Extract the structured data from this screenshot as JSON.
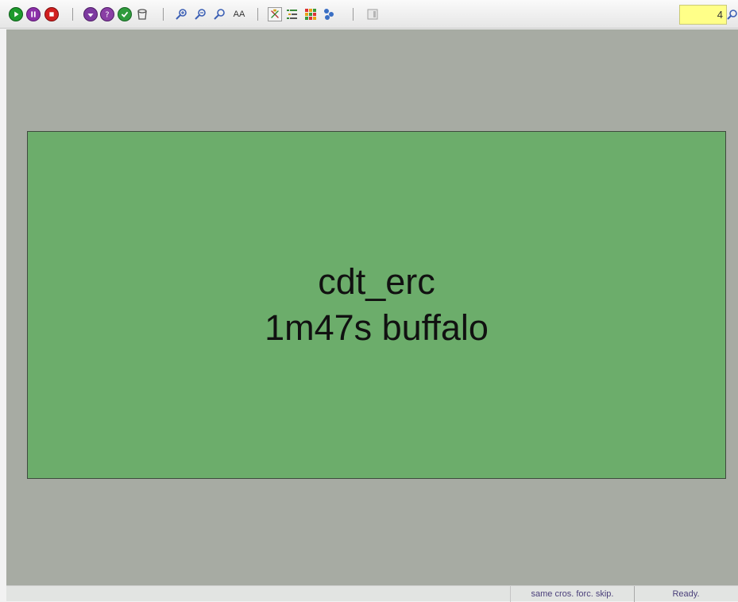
{
  "toolbar": {
    "run_icons": [
      "play-icon",
      "pause-icon",
      "stop-icon"
    ],
    "status_icons": [
      "down-arrow-icon",
      "question-icon",
      "check-icon",
      "bucket-icon"
    ],
    "zoom_icons": [
      "zoom-in-icon",
      "zoom-out-icon",
      "zoom-fit-icon",
      "font-size-icon"
    ],
    "font_size_label": "AA",
    "view_icons": [
      "tree-view-icon",
      "list-view-icon",
      "grid-view-icon",
      "tool-icon"
    ],
    "extra_icons": [
      "panel-icon"
    ],
    "zoom_value": "4"
  },
  "canvas": {
    "task": {
      "name": "cdt_erc",
      "detail": "1m47s buffalo"
    }
  },
  "status": {
    "flags": "same cros. forc. skip.",
    "state": "Ready."
  },
  "colors": {
    "canvas_bg": "#a7aba3",
    "task_fill": "#6cad6b",
    "zoom_field": "#ffff88",
    "play": "#1c9a2c",
    "pause": "#8b2fa8",
    "stop": "#d11f1f"
  }
}
